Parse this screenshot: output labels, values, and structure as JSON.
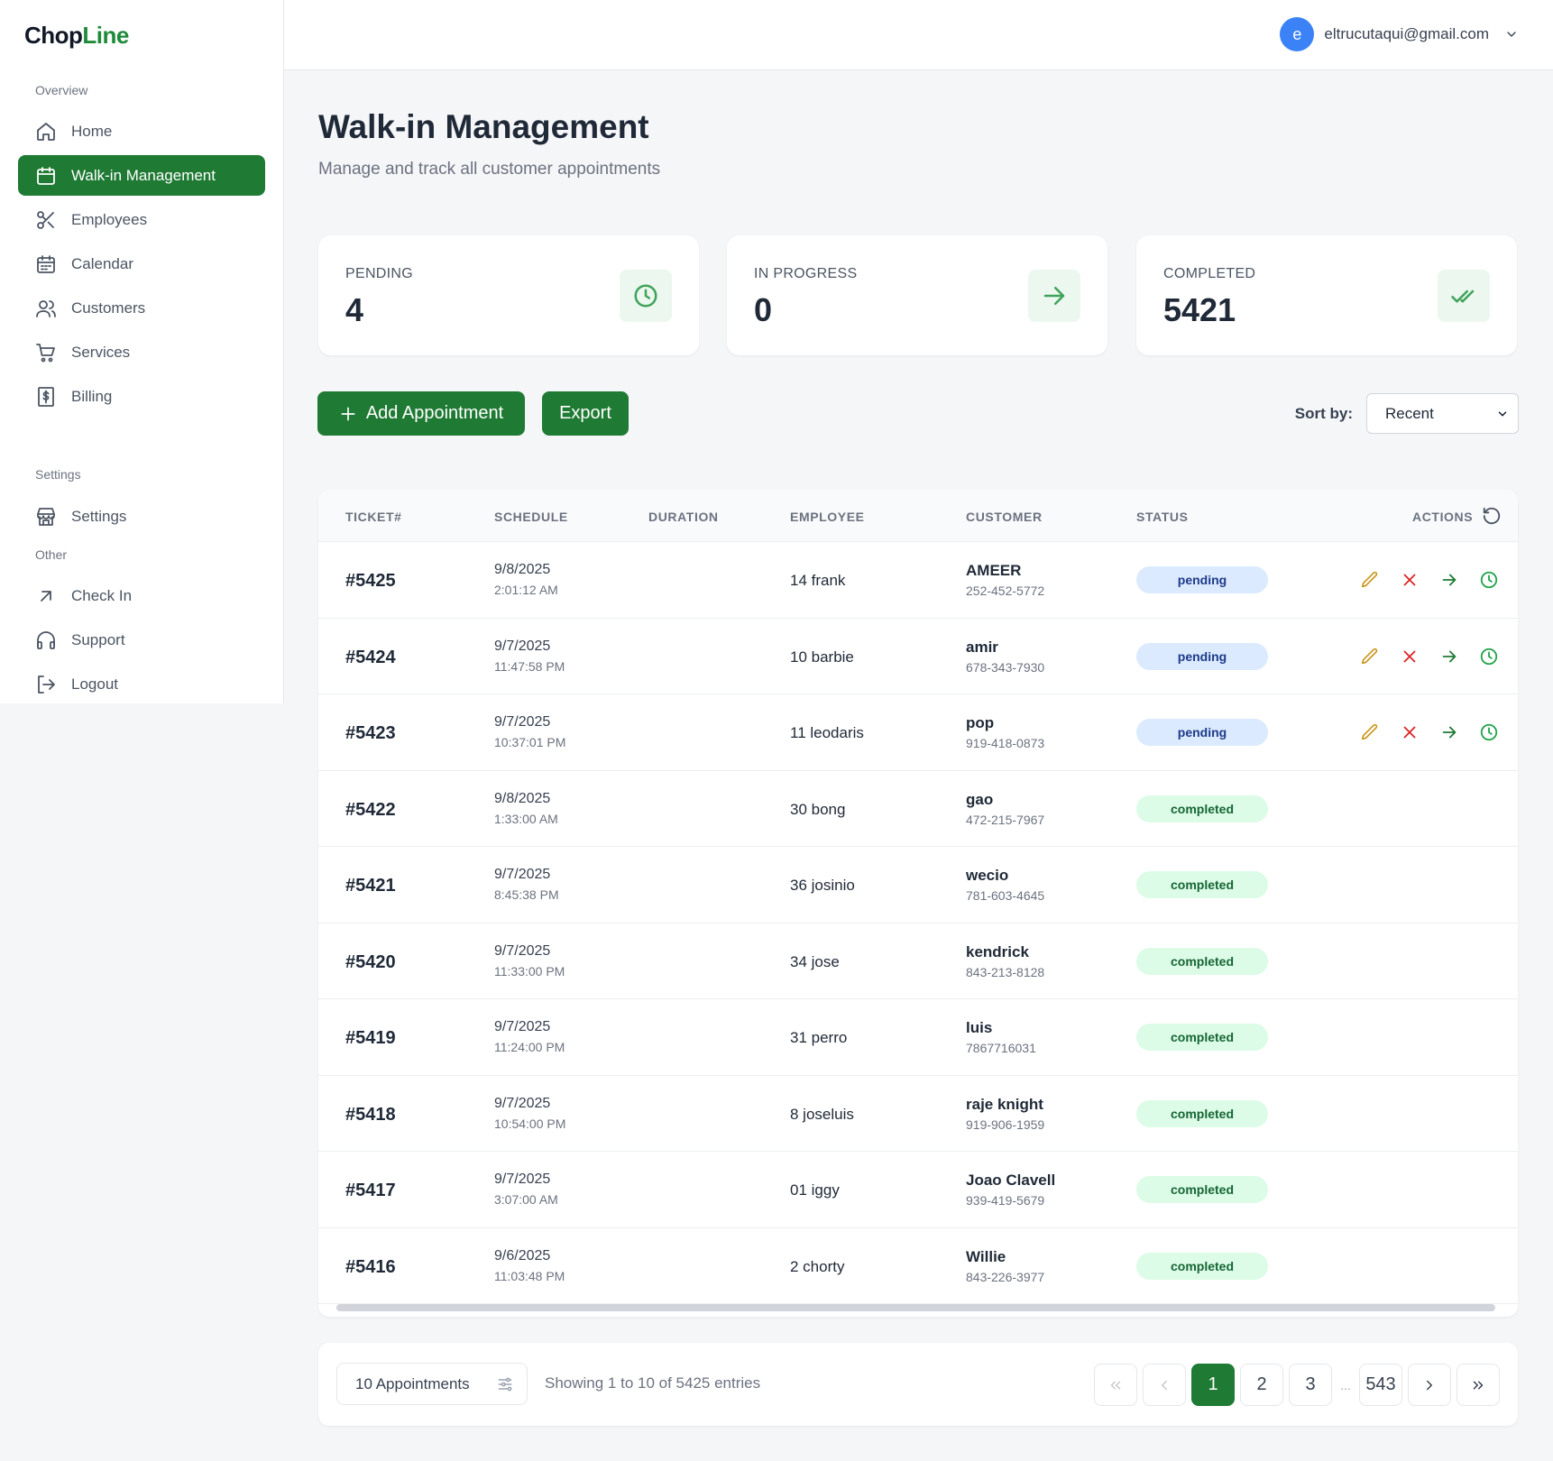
{
  "brand": {
    "part1": "Chop",
    "part2": "Line"
  },
  "sidebar": {
    "sections": {
      "overview": "Overview",
      "settings": "Settings",
      "other": "Other"
    },
    "items": [
      {
        "label": "Home",
        "icon": "home-icon"
      },
      {
        "label": "Walk-in Management",
        "icon": "calendar-icon",
        "active": true
      },
      {
        "label": "Employees",
        "icon": "scissors-icon"
      },
      {
        "label": "Calendar",
        "icon": "calendar-grid-icon"
      },
      {
        "label": "Customers",
        "icon": "users-icon"
      },
      {
        "label": "Services",
        "icon": "cart-icon"
      },
      {
        "label": "Billing",
        "icon": "dollar-receipt-icon"
      },
      {
        "label": "Settings",
        "icon": "store-icon"
      },
      {
        "label": "Check In",
        "icon": "arrow-up-left-icon"
      },
      {
        "label": "Support",
        "icon": "headphones-icon"
      },
      {
        "label": "Logout",
        "icon": "logout-icon"
      }
    ]
  },
  "user": {
    "initial": "e",
    "email": "eltrucutaqui@gmail.com"
  },
  "header": {
    "title": "Walk-in Management",
    "subtitle": "Manage and track all customer appointments"
  },
  "stats": [
    {
      "label": "PENDING",
      "value": "4",
      "icon": "clock-icon"
    },
    {
      "label": "IN PROGRESS",
      "value": "0",
      "icon": "arrow-right-icon"
    },
    {
      "label": "COMPLETED",
      "value": "5421",
      "icon": "double-check-icon"
    }
  ],
  "toolbar": {
    "add_label": "Add Appointment",
    "export_label": "Export",
    "sort_label": "Sort by:",
    "sort_value": "Recent"
  },
  "table": {
    "columns": [
      "TICKET#",
      "SCHEDULE",
      "DURATION",
      "EMPLOYEE",
      "CUSTOMER",
      "STATUS",
      "ACTIONS"
    ],
    "rows": [
      {
        "ticket": "#5425",
        "date": "9/8/2025",
        "time": "2:01:12 AM",
        "employee": "14 frank",
        "customer": "AMEER",
        "phone": "252-452-5772",
        "status": "pending"
      },
      {
        "ticket": "#5424",
        "date": "9/7/2025",
        "time": "11:47:58 PM",
        "employee": "10 barbie",
        "customer": "amir",
        "phone": "678-343-7930",
        "status": "pending"
      },
      {
        "ticket": "#5423",
        "date": "9/7/2025",
        "time": "10:37:01 PM",
        "employee": "11 leodaris",
        "customer": "pop",
        "phone": "919-418-0873",
        "status": "pending"
      },
      {
        "ticket": "#5422",
        "date": "9/8/2025",
        "time": "1:33:00 AM",
        "employee": "30 bong",
        "customer": "gao",
        "phone": "472-215-7967",
        "status": "completed"
      },
      {
        "ticket": "#5421",
        "date": "9/7/2025",
        "time": "8:45:38 PM",
        "employee": "36 josinio",
        "customer": "wecio",
        "phone": "781-603-4645",
        "status": "completed"
      },
      {
        "ticket": "#5420",
        "date": "9/7/2025",
        "time": "11:33:00 PM",
        "employee": "34 jose",
        "customer": "kendrick",
        "phone": "843-213-8128",
        "status": "completed"
      },
      {
        "ticket": "#5419",
        "date": "9/7/2025",
        "time": "11:24:00 PM",
        "employee": "31 perro",
        "customer": "luis",
        "phone": "7867716031",
        "status": "completed"
      },
      {
        "ticket": "#5418",
        "date": "9/7/2025",
        "time": "10:54:00 PM",
        "employee": "8 joseluis",
        "customer": "raje knight",
        "phone": "919-906-1959",
        "status": "completed"
      },
      {
        "ticket": "#5417",
        "date": "9/7/2025",
        "time": "3:07:00 AM",
        "employee": "01 iggy",
        "customer": "Joao Clavell",
        "phone": "939-419-5679",
        "status": "completed"
      },
      {
        "ticket": "#5416",
        "date": "9/6/2025",
        "time": "11:03:48 PM",
        "employee": "2 chorty",
        "customer": "Willie",
        "phone": "843-226-3977",
        "status": "completed"
      }
    ]
  },
  "footer": {
    "per_page": "10 Appointments",
    "showing": "Showing 1 to 10 of 5425 entries",
    "pages": [
      "1",
      "2",
      "3"
    ],
    "ellipsis": "...",
    "last_page": "543"
  },
  "colors": {
    "accent": "#1f7a34",
    "pending_bg": "#dbeafe",
    "completed_bg": "#dcfce7",
    "avatar": "#3b82f6"
  }
}
